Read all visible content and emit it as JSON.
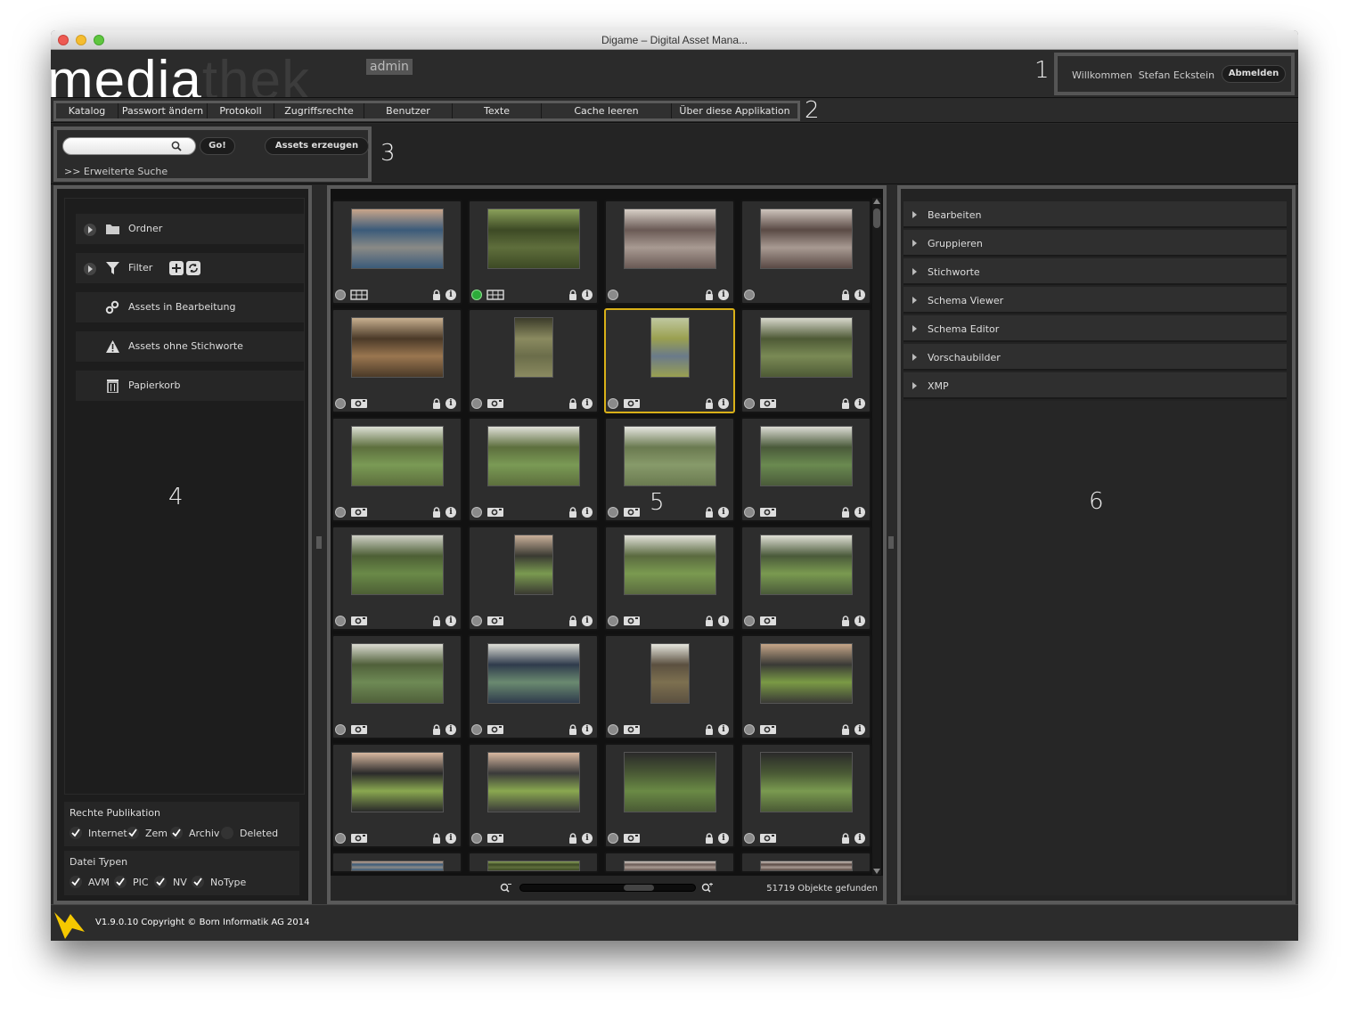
{
  "window": {
    "title": "Digame – Digital Asset Mana..."
  },
  "header": {
    "logo_light": "media",
    "logo_dark": "thek",
    "badge": "admin",
    "welcome_label": "Willkommen",
    "user_name": "Stefan Eckstein",
    "logout_label": "Abmelden"
  },
  "annotations": {
    "n1": "1",
    "n2": "2",
    "n3": "3",
    "n4": "4",
    "n5": "5",
    "n6": "6"
  },
  "menu": [
    {
      "label": "Katalog"
    },
    {
      "label": "Passwort ändern"
    },
    {
      "label": "Protokoll"
    },
    {
      "label": "Zugriffsrechte"
    },
    {
      "label": "Benutzer"
    },
    {
      "label": "Texte"
    },
    {
      "label": "Cache leeren"
    },
    {
      "label": "Über diese Applikation"
    }
  ],
  "search": {
    "value": "",
    "go_label": "Go!",
    "create_label": "Assets erzeugen",
    "advanced_label": ">> Erweiterte Suche"
  },
  "sidebar": {
    "items": [
      {
        "label": "Ordner",
        "icon": "folder-icon"
      },
      {
        "label": "Filter",
        "icon": "funnel-icon"
      },
      {
        "label": "Assets in Bearbeitung",
        "icon": "gears-icon"
      },
      {
        "label": "Assets ohne Stichworte",
        "icon": "warning-icon"
      },
      {
        "label": "Papierkorb",
        "icon": "trash-icon"
      }
    ],
    "rights": {
      "title": "Rechte Publikation",
      "options": [
        {
          "label": "Internet",
          "checked": true
        },
        {
          "label": "Zem",
          "checked": true
        },
        {
          "label": "Archiv",
          "checked": true
        },
        {
          "label": "Deleted",
          "checked": false
        }
      ]
    },
    "types": {
      "title": "Datei Typen",
      "options": [
        {
          "label": "AVM",
          "checked": true
        },
        {
          "label": "PIC",
          "checked": true
        },
        {
          "label": "NV",
          "checked": true
        },
        {
          "label": "NoType",
          "checked": true
        }
      ]
    }
  },
  "status": {
    "count_text": "51719 Objekte gefunden"
  },
  "panels": [
    {
      "label": "Bearbeiten"
    },
    {
      "label": "Gruppieren"
    },
    {
      "label": "Stichworte"
    },
    {
      "label": "Schema Viewer"
    },
    {
      "label": "Schema Editor"
    },
    {
      "label": "Vorschaubilder"
    },
    {
      "label": "XMP"
    }
  ],
  "footer": {
    "copyright": "V1.9.0.10 Copyright © Born Informatik AG 2014"
  },
  "colors": {
    "accent_selected": "#d9b018",
    "status_on": "#2cab3a",
    "logo_arrow": "#f5c800"
  }
}
